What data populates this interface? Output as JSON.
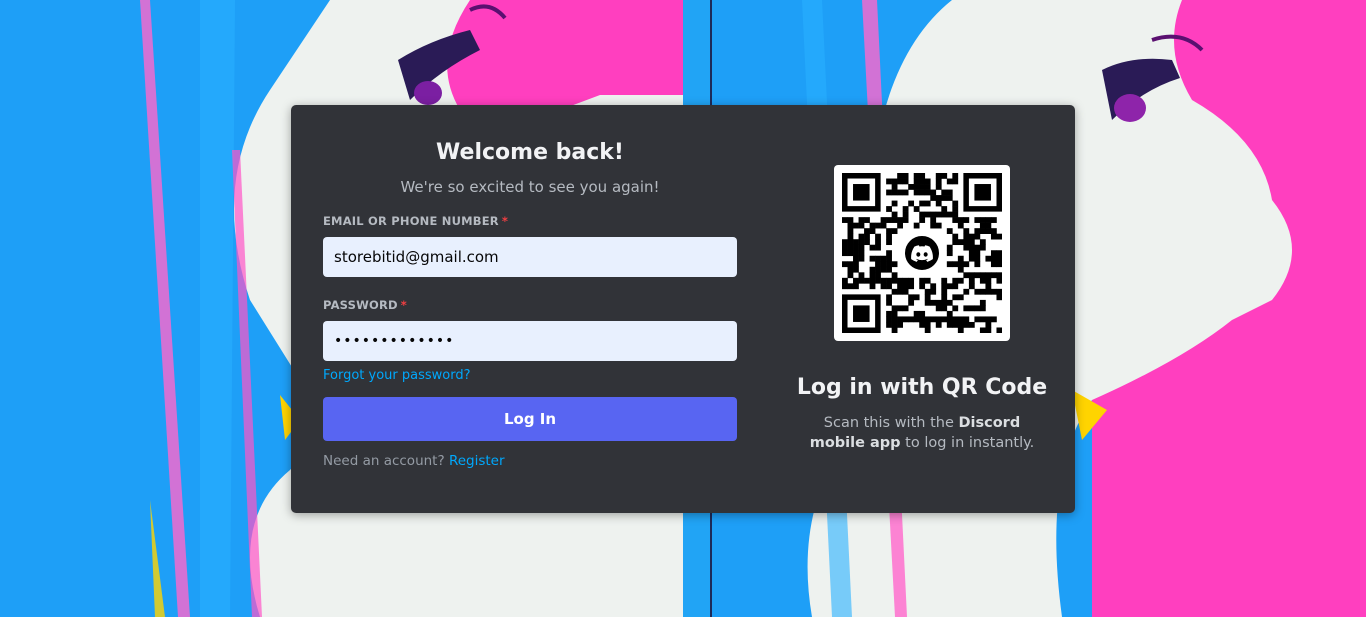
{
  "login": {
    "title": "Welcome back!",
    "subtitle": "We're so excited to see you again!",
    "email_label": "EMAIL OR PHONE NUMBER",
    "email_value": "storebitid@gmail.com",
    "password_label": "PASSWORD",
    "password_mask": "•••••••••••••",
    "required_marker": "*",
    "forgot_link": "Forgot your password?",
    "login_button": "Log In",
    "need_account": "Need an account?",
    "register_link": "Register"
  },
  "qr": {
    "title": "Log in with QR Code",
    "desc_prefix": "Scan this with the",
    "desc_bold": "Discord mobile app",
    "desc_suffix": "to log in instantly.",
    "logo_icon": "discord-logo-icon"
  },
  "colors": {
    "card_bg": "#313338",
    "accent": "#5865f2",
    "link": "#00a8fc",
    "required": "#f23f42",
    "input_bg": "#e8f0fe"
  }
}
